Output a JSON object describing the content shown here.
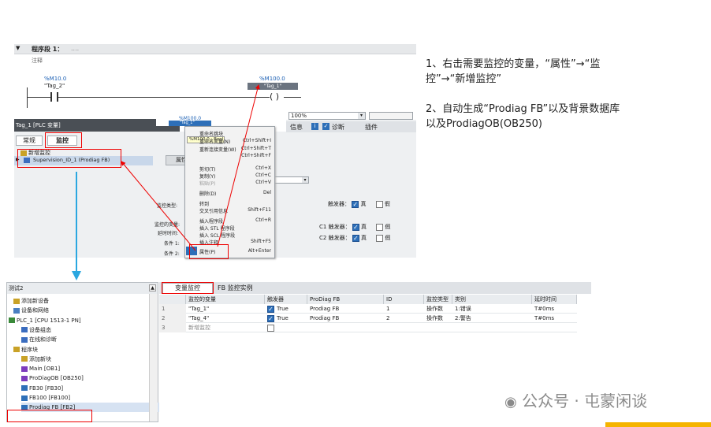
{
  "network": {
    "segment": "程序段 1：",
    "segment_dots": "....",
    "comment": "注释",
    "contact_addr": "%M10.0",
    "contact_tag": "\"Tag_2\"",
    "coil_addr": "%M100.0",
    "coil_tag": "\"Tag_1\""
  },
  "zoom": "100%",
  "props": {
    "title": "Tag_1 [PLC 变量]",
    "tab_general": "常规",
    "tab_monitor": "监控",
    "new_monitor": "新增监控",
    "supervision": "Supervision_ID_1 (Prodiag FB)",
    "attr_tab": "属性",
    "info_tab": "信息",
    "diag_tab": "诊断",
    "plugin_tab": "插件",
    "monitor_type": "监控类型:",
    "monitor_var": "监控的变量:",
    "delay": "延时时间:",
    "cond1": "条件 1:",
    "cond2": "条件 2:",
    "trigger": "触发器：",
    "c1_trigger": "C1 触发器：",
    "c2_trigger": "C2 触发器：",
    "true_label": "真",
    "false_label": "假"
  },
  "context_menu": {
    "header_addr": "%M100.0",
    "header_tag": "\"Tag_1\"",
    "tooltip": "%M100.0 : Bool",
    "items": [
      {
        "label": "重命名跳块",
        "shortcut": ""
      },
      {
        "label": "重命名变量(N)",
        "shortcut": "Ctrl+Shift+I"
      },
      {
        "label": "重新连接变量(W)",
        "shortcut": "Ctrl+Shift+T"
      },
      {
        "label": "",
        "shortcut": "Ctrl+Shift+F"
      },
      {
        "label": "剪切(T)",
        "shortcut": "Ctrl+X"
      },
      {
        "label": "复制(Y)",
        "shortcut": "Ctrl+C"
      },
      {
        "label": "粘贴(P)",
        "shortcut": "Ctrl+V"
      },
      {
        "label": "删除(D)",
        "shortcut": "Del"
      },
      {
        "label": "转到",
        "shortcut": ""
      },
      {
        "label": "交叉引用信息",
        "shortcut": "Shift+F11"
      },
      {
        "label": "插入程序段",
        "shortcut": "Ctrl+R"
      },
      {
        "label": "插入 STL 程序段",
        "shortcut": ""
      },
      {
        "label": "插入 SCL 程序段",
        "shortcut": ""
      },
      {
        "label": "插入注释",
        "shortcut": "Shift+F5"
      },
      {
        "label": "属性(P)",
        "shortcut": "Alt+Enter"
      }
    ]
  },
  "notes": {
    "step1_line1": "1、右击需要监控的变量，“属性”→“监",
    "step1_line2": "控”→“新增监控”",
    "step2_line1": "2、自动生成“Prodiag FB”以及背景数据库",
    "step2_line2": "以及ProdiagOB(OB250)"
  },
  "tree": {
    "root": "测试2",
    "items": [
      "添加新设备",
      "设备和网络",
      "PLC_1 [CPU 1513-1 PN]",
      "设备组态",
      "在线和诊断",
      "程序块",
      "添加新块",
      "Main [OB1]",
      "ProDiagOB [OB250]",
      "FB30 [FB30]",
      "FB100 [FB100]",
      "Prodiag FB [FB2]"
    ]
  },
  "grid": {
    "tab_var": "变量监控",
    "tab_fb": "FB 监控实例",
    "headers": [
      "监控的变量",
      "触发器",
      "ProDiag FB",
      "ID",
      "监控类型",
      "类别",
      "延时时间"
    ],
    "rows": [
      {
        "num": "1",
        "var": "\"Tag_1\"",
        "trigger": "True",
        "fb": "Prodiag FB",
        "id": "1",
        "type": "操作数",
        "cat": "1:错误",
        "delay": "T#0ms"
      },
      {
        "num": "2",
        "var": "\"Tag_4\"",
        "trigger": "True",
        "fb": "Prodiag FB",
        "id": "2",
        "type": "操作数",
        "cat": "2:警告",
        "delay": "T#0ms"
      },
      {
        "num": "3",
        "var": "新增监控",
        "trigger": "",
        "fb": "",
        "id": "",
        "type": "",
        "cat": "",
        "delay": ""
      }
    ]
  },
  "watermark": "公众号 · 屯蒙闲谈"
}
